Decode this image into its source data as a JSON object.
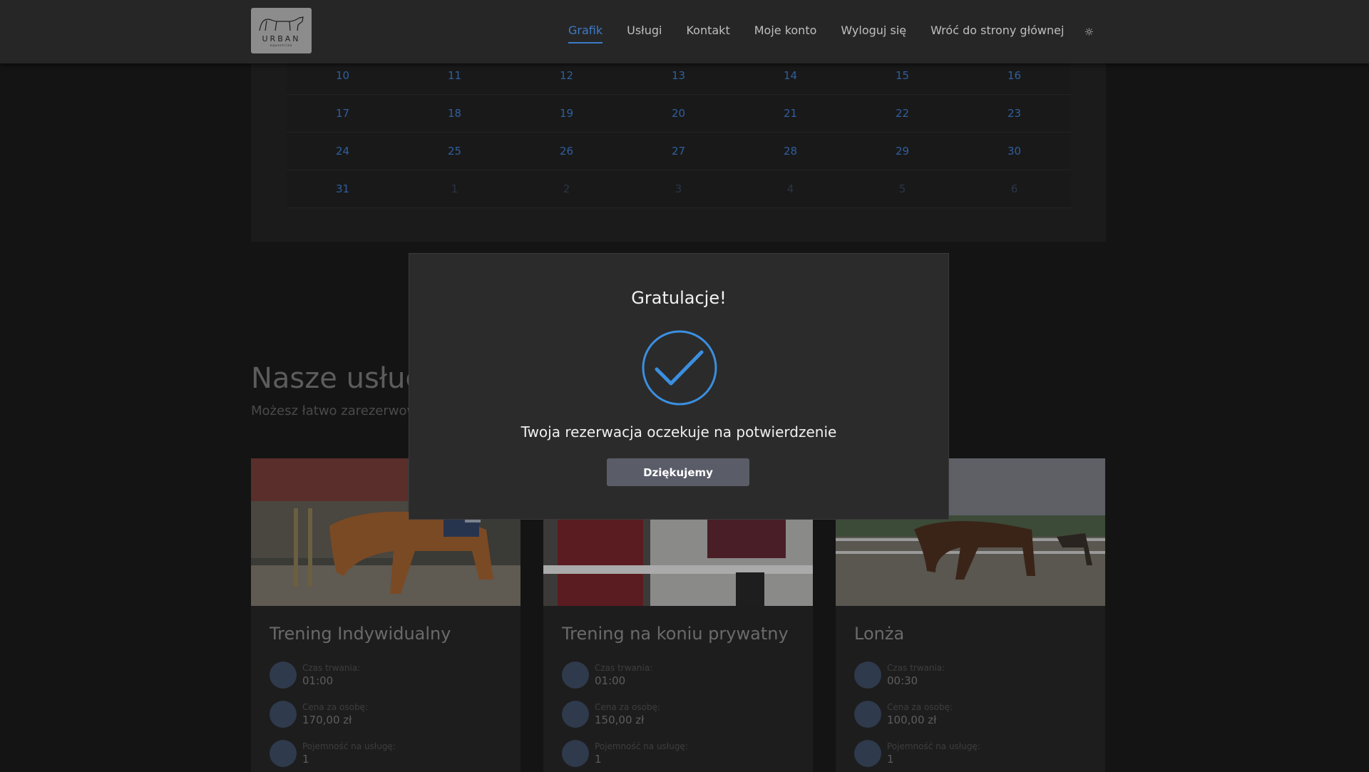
{
  "nav": {
    "logo_text": "URBAN",
    "logo_sub": "equestrian",
    "items": [
      "Grafik",
      "Usługi",
      "Kontakt",
      "Moje konto",
      "Wyloguj się",
      "Wróć do strony głównej"
    ],
    "active": "Grafik",
    "theme_icon": "sun-icon"
  },
  "calendar": {
    "rows": [
      [
        "10",
        "11",
        "12",
        "13",
        "14",
        "15",
        "16"
      ],
      [
        "17",
        "18",
        "19",
        "20",
        "21",
        "22",
        "23"
      ],
      [
        "24",
        "25",
        "26",
        "27",
        "28",
        "29",
        "30"
      ],
      [
        "31",
        "1",
        "2",
        "3",
        "4",
        "5",
        "6"
      ]
    ]
  },
  "services": {
    "title": "Nasze usług",
    "subtitle": "Możesz łatwo zarezerwow",
    "cards": [
      {
        "name": "Trening Indywidualny",
        "duration_label": "Czas trwania:",
        "duration": "01:00",
        "price_label": "Cena za osobę:",
        "price": "170,00 zł",
        "capacity_label": "Pojemność na usługę:",
        "capacity": "1"
      },
      {
        "name": "Trening na koniu prywatny",
        "duration_label": "Czas trwania:",
        "duration": "01:00",
        "price_label": "Cena za osobę:",
        "price": "150,00 zł",
        "capacity_label": "Pojemność na usługę:",
        "capacity": "1"
      },
      {
        "name": "Lonża",
        "duration_label": "Czas trwania:",
        "duration": "00:30",
        "price_label": "Cena za osobę:",
        "price": "100,00 zł",
        "capacity_label": "Pojemność na usługę:",
        "capacity": "1"
      }
    ]
  },
  "modal": {
    "title": "Gratulacje!",
    "message": "Twoja rezerwacja oczekuje na potwierdzenie",
    "button": "Dziękujemy",
    "icon": "check-circle-icon"
  },
  "colors": {
    "accent": "#3d7bc8",
    "check": "#3b8fe0",
    "modal_bg": "#2b2b2b",
    "button_bg": "#5a5d68"
  }
}
